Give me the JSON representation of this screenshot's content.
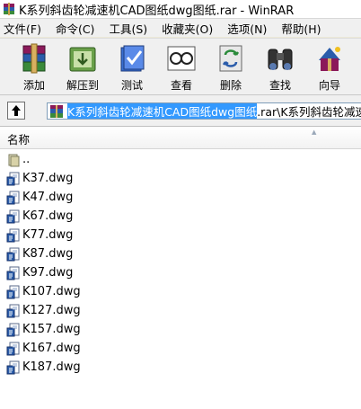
{
  "window": {
    "title": "K系列斜齿轮减速机CAD图纸dwg图纸.rar - WinRAR"
  },
  "menu": [
    "文件(F)",
    "命令(C)",
    "工具(S)",
    "收藏夹(O)",
    "选项(N)",
    "帮助(H)"
  ],
  "toolbar": {
    "add": "添加",
    "extract": "解压到",
    "test": "测试",
    "view": "查看",
    "delete": "删除",
    "find": "查找",
    "wizard": "向导"
  },
  "path": {
    "selected": "K系列斜齿轮减速机CAD图纸dwg图纸",
    "rest": ".rar\\K系列斜齿轮减速机"
  },
  "columns": {
    "name": "名称"
  },
  "files": [
    {
      "name": "..",
      "icon": "folder-up-icon"
    },
    {
      "name": "K37.dwg",
      "icon": "dwg-file-icon"
    },
    {
      "name": "K47.dwg",
      "icon": "dwg-file-icon"
    },
    {
      "name": "K67.dwg",
      "icon": "dwg-file-icon"
    },
    {
      "name": "K77.dwg",
      "icon": "dwg-file-icon"
    },
    {
      "name": "K87.dwg",
      "icon": "dwg-file-icon"
    },
    {
      "name": "K97.dwg",
      "icon": "dwg-file-icon"
    },
    {
      "name": "K107.dwg",
      "icon": "dwg-file-icon"
    },
    {
      "name": "K127.dwg",
      "icon": "dwg-file-icon"
    },
    {
      "name": "K157.dwg",
      "icon": "dwg-file-icon"
    },
    {
      "name": "K167.dwg",
      "icon": "dwg-file-icon"
    },
    {
      "name": "K187.dwg",
      "icon": "dwg-file-icon"
    }
  ],
  "colors": {
    "selection": "#3399ff",
    "path_border": "#7f9db9"
  }
}
